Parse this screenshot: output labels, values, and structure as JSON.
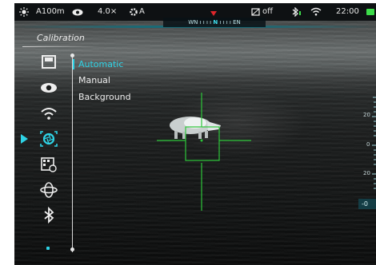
{
  "status_bar": {
    "profile": "A100m",
    "zoom": "4.0×",
    "mode": "A",
    "recording_label": "off",
    "time": "22:00"
  },
  "compass": {
    "left": "WN",
    "center": "N",
    "right": "EN"
  },
  "menu": {
    "title": "Calibration",
    "icons": [
      "save-icon",
      "eye-icon",
      "wifi-icon",
      "calibration-shutter-icon",
      "gallery-settings-icon",
      "orbit-icon",
      "bluetooth-icon"
    ],
    "options": [
      "Automatic",
      "Manual",
      "Background"
    ],
    "selected_option": "Automatic"
  },
  "scale": {
    "tick_top": "20",
    "tick_mid": "0",
    "tick_bottom": "20",
    "readout": "-0"
  },
  "colors": {
    "accent": "#2ed3e6",
    "reticle": "#2dc63a",
    "pointer": "#e0262b",
    "battery": "#3ddc4a"
  }
}
